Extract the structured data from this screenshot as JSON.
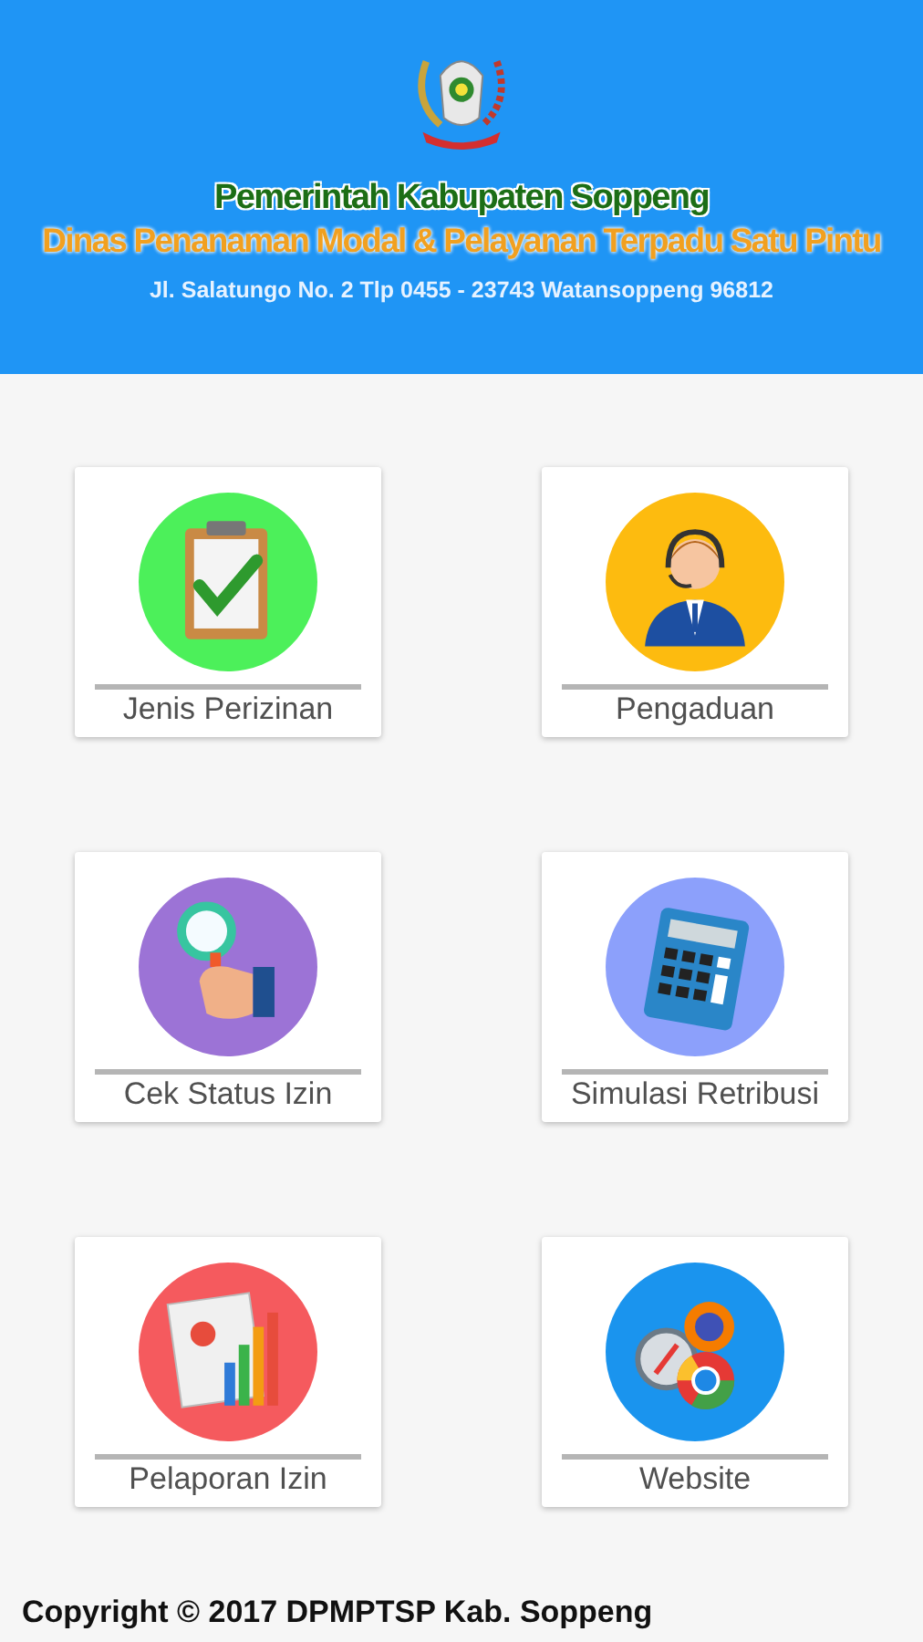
{
  "header": {
    "agency": "Pemerintah Kabupaten Soppeng",
    "office": "Dinas Penanaman Modal & Pelayanan Terpadu Satu Pintu",
    "address": "Jl. Salatungo No. 2 Tlp 0455 - 23743 Watansoppeng 96812"
  },
  "menu": [
    {
      "label": "Jenis Perizinan",
      "kind": "clipboard",
      "color": "#4cf05a"
    },
    {
      "label": "Pengaduan",
      "kind": "operator",
      "color": "#fdbb0f"
    },
    {
      "label": "Cek Status Izin",
      "kind": "magnifier",
      "color": "#9c73d6"
    },
    {
      "label": "Simulasi Retribusi",
      "kind": "calculator",
      "color": "#8ca0fb"
    },
    {
      "label": "Pelaporan Izin",
      "kind": "report",
      "color": "#f55a5e"
    },
    {
      "label": "Website",
      "kind": "browsers",
      "color": "#1a94ee"
    }
  ],
  "footer": "Copyright © 2017 DPMPTSP Kab. Soppeng"
}
